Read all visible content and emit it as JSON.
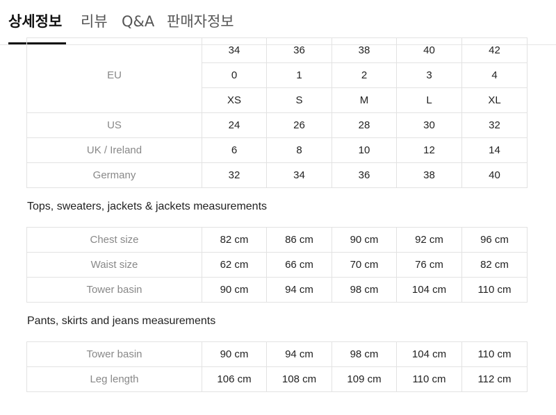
{
  "tabs": [
    {
      "label": "상세정보",
      "active": true
    },
    {
      "label": "리뷰"
    },
    {
      "label": "Q&A"
    },
    {
      "label": "판매자정보"
    }
  ],
  "size_table": {
    "eu_label": "EU",
    "eu_rows": [
      [
        "34",
        "36",
        "38",
        "40",
        "42"
      ],
      [
        "0",
        "1",
        "2",
        "3",
        "4"
      ],
      [
        "XS",
        "S",
        "M",
        "L",
        "XL"
      ]
    ],
    "rows": [
      {
        "label": "US",
        "values": [
          "24",
          "26",
          "28",
          "30",
          "32"
        ]
      },
      {
        "label": "UK / Ireland",
        "values": [
          "6",
          "8",
          "10",
          "12",
          "14"
        ]
      },
      {
        "label": "Germany",
        "values": [
          "32",
          "34",
          "36",
          "38",
          "40"
        ]
      }
    ]
  },
  "tops": {
    "title": "Tops, sweaters, jackets & jackets measurements",
    "rows": [
      {
        "label": "Chest size",
        "values": [
          "82 cm",
          "86 cm",
          "90 cm",
          "92 cm",
          "96 cm"
        ]
      },
      {
        "label": "Waist size",
        "values": [
          "62 cm",
          "66 cm",
          "70 cm",
          "76 cm",
          "82 cm"
        ]
      },
      {
        "label": "Tower basin",
        "values": [
          "90 cm",
          "94 cm",
          "98 cm",
          "104 cm",
          "110 cm"
        ]
      }
    ]
  },
  "pants": {
    "title": "Pants, skirts and jeans measurements",
    "rows": [
      {
        "label": "Tower basin",
        "values": [
          "90 cm",
          "94 cm",
          "98 cm",
          "104 cm",
          "110 cm"
        ]
      },
      {
        "label": "Leg length",
        "values": [
          "106 cm",
          "108 cm",
          "109 cm",
          "110 cm",
          "112 cm"
        ]
      }
    ]
  }
}
